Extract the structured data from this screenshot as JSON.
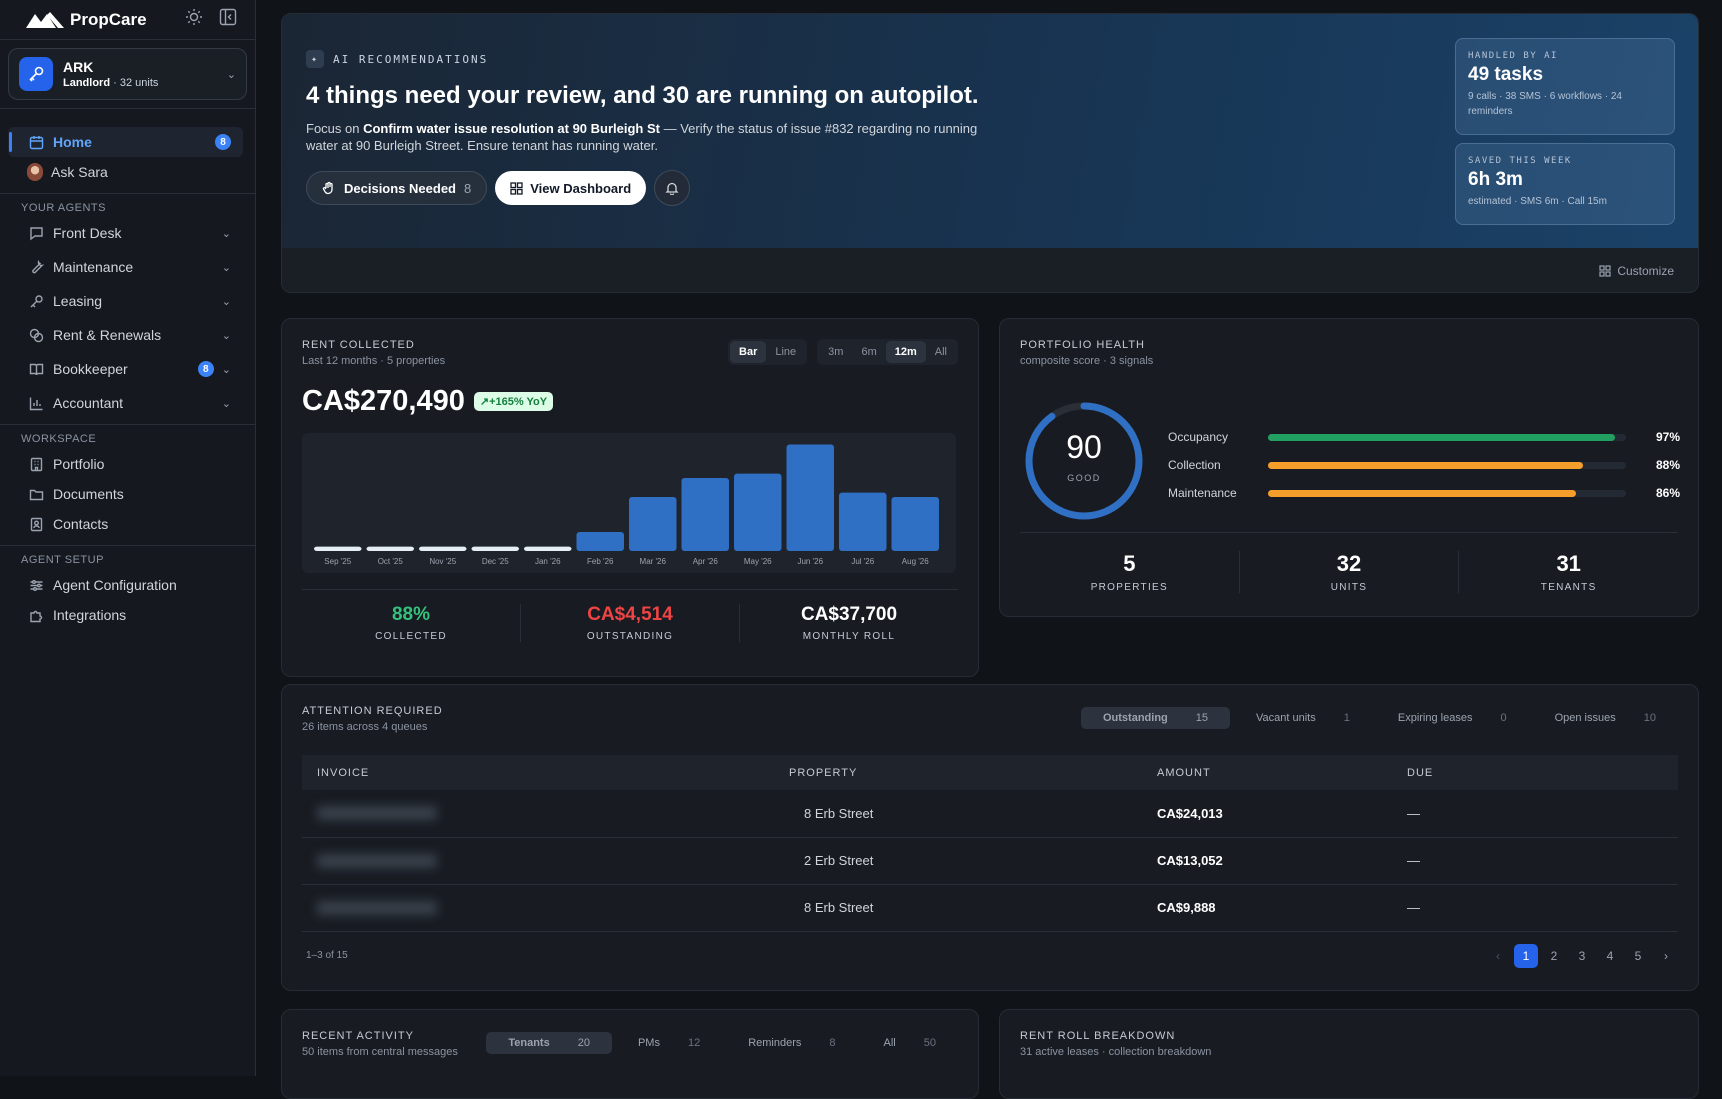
{
  "app": {
    "name": "PropCare"
  },
  "org": {
    "name": "ARK",
    "role": "Landlord",
    "units": "· 32 units"
  },
  "nav": {
    "home": {
      "label": "Home",
      "badge": "8"
    },
    "ask": {
      "label": "Ask Sara"
    },
    "agents_header": "YOUR AGENTS",
    "agents": [
      {
        "label": "Front Desk"
      },
      {
        "label": "Maintenance"
      },
      {
        "label": "Leasing"
      },
      {
        "label": "Rent & Renewals"
      },
      {
        "label": "Bookkeeper",
        "badge": "8"
      },
      {
        "label": "Accountant"
      }
    ],
    "workspace_header": "WORKSPACE",
    "workspace": [
      {
        "label": "Portfolio"
      },
      {
        "label": "Documents"
      },
      {
        "label": "Contacts"
      }
    ],
    "setup_header": "AGENT SETUP",
    "setup": [
      {
        "label": "Agent Configuration"
      },
      {
        "label": "Integrations"
      }
    ]
  },
  "hero": {
    "tag": "AI RECOMMENDATIONS",
    "title": "4 things need your review, and 30 are running on autopilot.",
    "focus_prefix": "Focus on ",
    "focus_bold": "Confirm water issue resolution at 90 Burleigh St",
    "focus_rest": " — Verify the status of issue #832 regarding no running water at 90 Burleigh Street. Ensure tenant has running water.",
    "decisions_label": "Decisions Needed",
    "decisions_count": "8",
    "dashboard_label": "View Dashboard",
    "handled": {
      "label": "HANDLED BY AI",
      "value": "49 tasks",
      "sub": "9 calls · 38 SMS · 6 workflows · 24 reminders"
    },
    "saved": {
      "label": "SAVED THIS WEEK",
      "value": "6h 3m",
      "sub": "estimated · SMS 6m · Call 15m"
    },
    "customize": "Customize"
  },
  "rent": {
    "title": "RENT COLLECTED",
    "subtitle": "Last 12 months · 5 properties",
    "chart_types": [
      "Bar",
      "Line"
    ],
    "ranges": [
      "3m",
      "6m",
      "12m",
      "All"
    ],
    "total": "CA$270,490",
    "yoy": "+165% YoY",
    "kpis": [
      {
        "value": "88%",
        "label": "COLLECTED",
        "color": "#34c27a"
      },
      {
        "value": "CA$4,514",
        "label": "OUTSTANDING",
        "color": "#ef4444"
      },
      {
        "value": "CA$37,700",
        "label": "MONTHLY ROLL",
        "color": "#ffffff"
      }
    ]
  },
  "chart_data": {
    "type": "bar",
    "categories": [
      "Sep '25",
      "Oct '25",
      "Nov '25",
      "Dec '25",
      "Jan '26",
      "Feb '26",
      "Mar '26",
      "Apr '26",
      "May '26",
      "Jun '26",
      "Jul '26",
      "Aug '26"
    ],
    "values": [
      1500,
      1500,
      1500,
      1500,
      1500,
      6500,
      18500,
      25000,
      26500,
      36500,
      20000,
      18500
    ],
    "ylim": [
      0,
      37000
    ],
    "bar_color": "#2f6fc4",
    "grid": false
  },
  "health": {
    "title": "PORTFOLIO HEALTH",
    "subtitle": "composite score · 3 signals",
    "score": "90",
    "score_label": "GOOD",
    "score_fraction": 0.9,
    "bars": [
      {
        "label": "Occupancy",
        "pct": "97%",
        "value": 0.97,
        "color": "#22a062"
      },
      {
        "label": "Collection",
        "pct": "88%",
        "value": 0.88,
        "color": "#f59e2b"
      },
      {
        "label": "Maintenance",
        "pct": "86%",
        "value": 0.86,
        "color": "#f59e2b"
      }
    ],
    "stats": [
      {
        "value": "5",
        "label": "PROPERTIES"
      },
      {
        "value": "32",
        "label": "UNITS"
      },
      {
        "value": "31",
        "label": "TENANTS"
      }
    ]
  },
  "attention": {
    "title": "ATTENTION REQUIRED",
    "subtitle": "26 items across 4 queues",
    "tabs": [
      {
        "label": "Outstanding",
        "count": "15"
      },
      {
        "label": "Vacant units",
        "count": "1"
      },
      {
        "label": "Expiring leases",
        "count": "0"
      },
      {
        "label": "Open issues",
        "count": "10"
      }
    ],
    "columns": [
      "INVOICE",
      "PROPERTY",
      "AMOUNT",
      "DUE"
    ],
    "rows": [
      {
        "property": "8 Erb Street",
        "amount": "CA$24,013",
        "due": "—"
      },
      {
        "property": "2 Erb Street",
        "amount": "CA$13,052",
        "due": "—"
      },
      {
        "property": "8 Erb Street",
        "amount": "CA$9,888",
        "due": "—"
      }
    ],
    "range": "1–3 of 15",
    "pages": [
      "‹",
      "1",
      "2",
      "3",
      "4",
      "5",
      "›"
    ]
  },
  "activity": {
    "title": "RECENT ACTIVITY",
    "subtitle": "50 items from central messages",
    "tabs": [
      {
        "label": "Tenants",
        "count": "20"
      },
      {
        "label": "PMs",
        "count": "12"
      },
      {
        "label": "Reminders",
        "count": "8"
      },
      {
        "label": "All",
        "count": "50"
      }
    ]
  },
  "rollbreak": {
    "title": "RENT ROLL BREAKDOWN",
    "subtitle": "31 active leases · collection breakdown"
  }
}
